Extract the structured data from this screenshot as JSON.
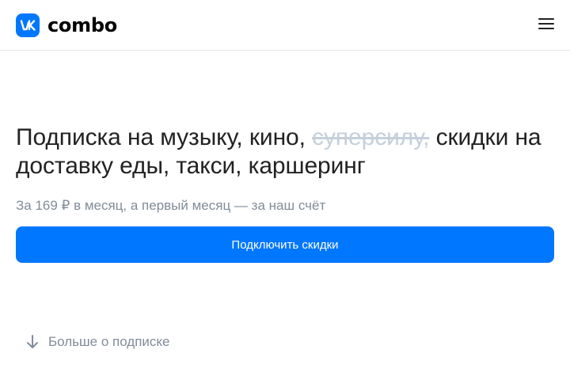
{
  "header": {
    "logo_text": "combo",
    "logo_icon": "vk-logo-icon",
    "menu_icon": "hamburger-menu-icon"
  },
  "hero": {
    "headline_part1": "Подписка на музыку, кино, ",
    "headline_strike": "суперсилу,",
    "headline_part2": " скидки на доставку еды, такси, каршеринг",
    "price_line": "За 169 ₽ в месяц, а первый месяц — за наш счёт",
    "cta_label": "Подключить скидки"
  },
  "more": {
    "label": "Больше о подписке",
    "icon": "arrow-down-icon"
  },
  "colors": {
    "brand": "#0077ff",
    "text": "#222222",
    "muted": "#818c99",
    "strike": "#c5d0db"
  }
}
